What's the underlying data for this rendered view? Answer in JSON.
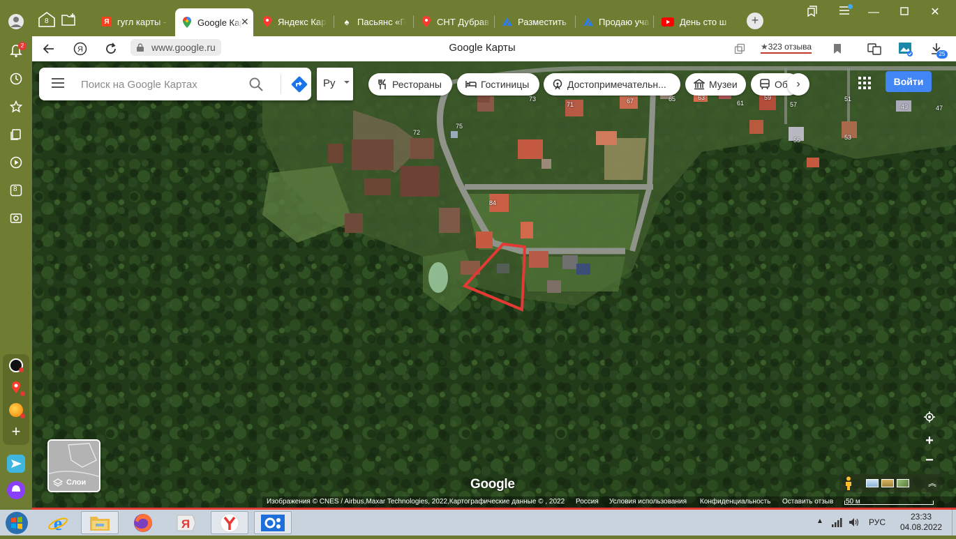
{
  "colors": {
    "browser_chrome": "#6f7d33",
    "accent": "#4285f4",
    "plot_outline": "#e53935"
  },
  "sidebar": {
    "notification_badge": "2",
    "tab_count": "8"
  },
  "tabs": {
    "counter": "8",
    "items": [
      {
        "label": "гугл карты -",
        "icon": "yandex-icon"
      },
      {
        "label": "Google Карты",
        "icon": "google-maps-icon",
        "active": true
      },
      {
        "label": "Яндекс Карты",
        "icon": "map-pin-icon"
      },
      {
        "label": "Пасьянс «Го",
        "icon": "spade-icon"
      },
      {
        "label": "СНТ Дубрав",
        "icon": "map-pin-icon"
      },
      {
        "label": "Разместить",
        "icon": "avito-icon"
      },
      {
        "label": "Продаю уча",
        "icon": "avito-icon"
      },
      {
        "label": "День сто ш",
        "icon": "youtube-icon"
      }
    ]
  },
  "address_bar": {
    "url": "www.google.ru",
    "page_title": "Google Карты",
    "reviews": "323 отзыва",
    "downloads_badge": "25"
  },
  "map": {
    "search": {
      "placeholder": "Поиск на Google Картах"
    },
    "language": "Ру",
    "chips": [
      {
        "label": "Рестораны",
        "icon": "fork-knife-icon"
      },
      {
        "label": "Гостиницы",
        "icon": "bed-icon"
      },
      {
        "label": "Достопримечательн...",
        "icon": "attraction-icon"
      },
      {
        "label": "Музеи",
        "icon": "museum-icon"
      },
      {
        "label": "Об",
        "icon": "transit-icon"
      }
    ],
    "signin_label": "Войти",
    "house_numbers": [
      "73",
      "71",
      "67",
      "65",
      "63",
      "61",
      "59",
      "57",
      "51",
      "49",
      "47",
      "72",
      "75",
      "55",
      "53",
      "84"
    ],
    "layers_label": "Слои",
    "google_logo": "Google",
    "attribution": {
      "imagery": "Изображения © CNES / Airbus,Maxar Technologies, 2022,Картографические данные © , 2022",
      "country": "Россия",
      "terms": "Условия использования",
      "privacy": "Конфиденциальность",
      "feedback": "Оставить отзыв",
      "scale": "50 м"
    }
  },
  "taskbar": {
    "apps": [
      "internet-explorer-icon",
      "file-explorer-icon",
      "firefox-icon",
      "yandex-launcher-icon",
      "yandex-browser-icon",
      "ok-icon"
    ],
    "language": "РУС",
    "time": "23:33",
    "date": "04.08.2022"
  }
}
